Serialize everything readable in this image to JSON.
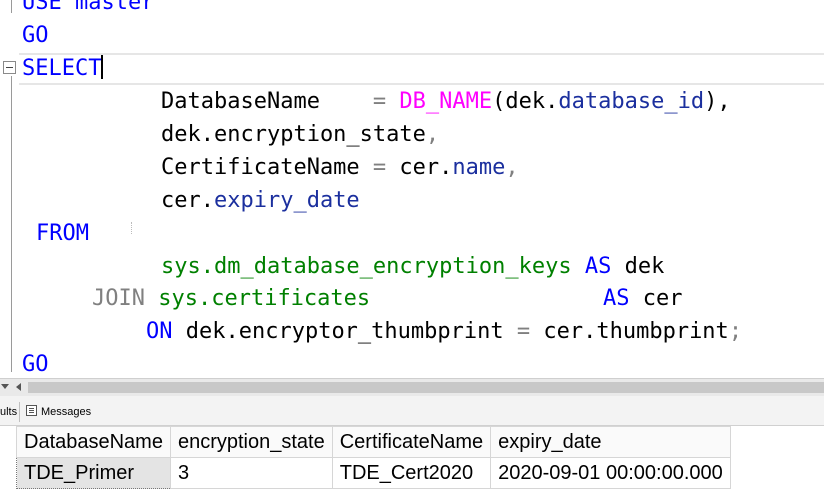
{
  "editor": {
    "lines": [
      {
        "id": "use",
        "text": "USE master"
      },
      {
        "id": "go1",
        "text": "GO"
      },
      {
        "id": "select",
        "text": "SELECT"
      },
      {
        "id": "l4a",
        "text": "DatabaseName    "
      },
      {
        "id": "l4b",
        "text": "="
      },
      {
        "id": "l4c",
        "text": "DB_NAME"
      },
      {
        "id": "l4d",
        "text": "(dek."
      },
      {
        "id": "l4e",
        "text": "database_id"
      },
      {
        "id": "l4f",
        "text": "),"
      },
      {
        "id": "l5a",
        "text": "dek.encryption_state"
      },
      {
        "id": "l5b",
        "text": ","
      },
      {
        "id": "l6a",
        "text": "CertificateName "
      },
      {
        "id": "l6b",
        "text": "="
      },
      {
        "id": "l6c",
        "text": " cer."
      },
      {
        "id": "l6d",
        "text": "name"
      },
      {
        "id": "l6e",
        "text": ","
      },
      {
        "id": "l7a",
        "text": "cer."
      },
      {
        "id": "l7b",
        "text": "expiry_date"
      },
      {
        "id": "from",
        "text": "FROM"
      },
      {
        "id": "l9a",
        "text": "sys.dm_database_encryption_keys"
      },
      {
        "id": "l9b",
        "text": "AS"
      },
      {
        "id": "l9c",
        "text": " dek"
      },
      {
        "id": "l10a",
        "text": "JOIN"
      },
      {
        "id": "l10b",
        "text": "sys.certificates"
      },
      {
        "id": "l10c",
        "text": "AS"
      },
      {
        "id": "l10d",
        "text": " cer"
      },
      {
        "id": "l11a",
        "text": "ON"
      },
      {
        "id": "l11b",
        "text": " dek.encryptor_thumbprint "
      },
      {
        "id": "l11c",
        "text": "="
      },
      {
        "id": "l11d",
        "text": " cer.thumbprint"
      },
      {
        "id": "l11e",
        "text": ";"
      },
      {
        "id": "go2",
        "text": "GO"
      }
    ]
  },
  "tabs": {
    "results_label": "ults",
    "messages_label": "Messages",
    "messages_icon": "messages-icon"
  },
  "results": {
    "columns": [
      "DatabaseName",
      "encryption_state",
      "CertificateName",
      "expiry_date"
    ],
    "rows": [
      [
        "TDE_Primer",
        "3",
        "TDE_Cert2020",
        "2020-09-01 00:00:00.000"
      ]
    ]
  },
  "colors": {
    "keyword": "#0000ff",
    "function": "#ff00ff",
    "system_object": "#008000",
    "column": "#1b2f9e",
    "operator": "#808080"
  }
}
